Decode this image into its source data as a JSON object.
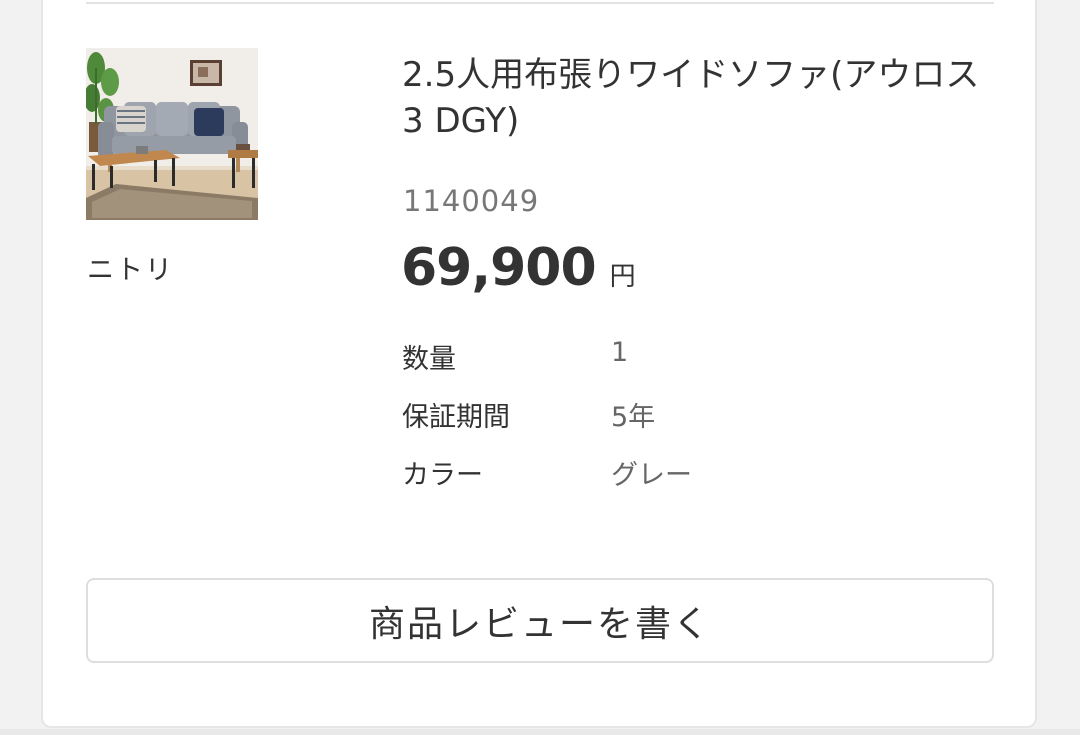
{
  "product": {
    "title": "2.5人用布張りワイドソファ(アウロス3 DGY)",
    "code": "1140049",
    "brand": "ニトリ",
    "price": "69,900",
    "currency": "円",
    "image_icon": "sofa-product-photo"
  },
  "specs": [
    {
      "label": "数量",
      "value": "1"
    },
    {
      "label": "保証期間",
      "value": "5年"
    },
    {
      "label": "カラー",
      "value": "グレー"
    }
  ],
  "actions": {
    "review_label": "商品レビューを書く"
  },
  "colors": {
    "text": "#333333",
    "muted": "#777777",
    "border": "#dedede",
    "background": "#ffffff"
  }
}
